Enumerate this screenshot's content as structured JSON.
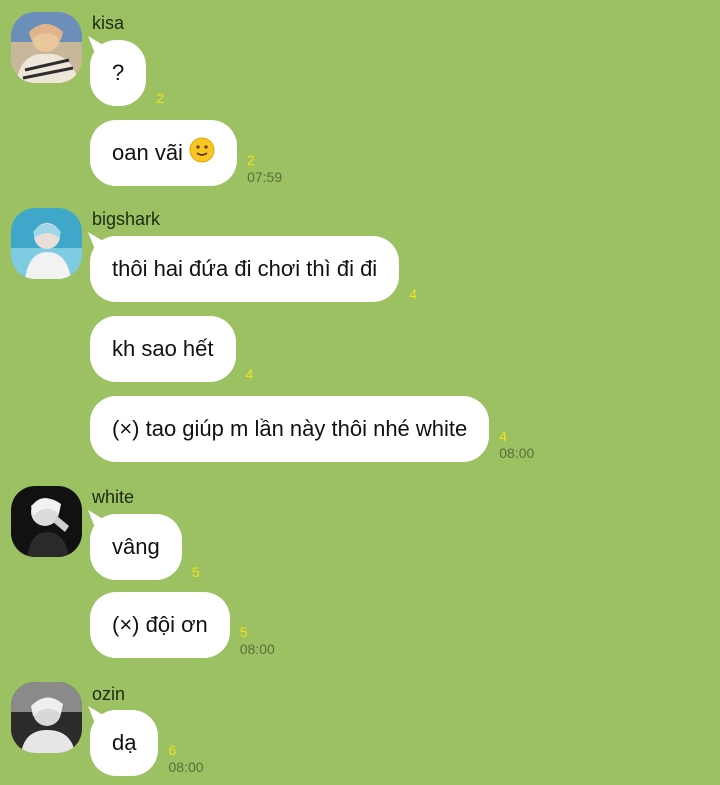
{
  "colors": {
    "background": "#9bc162",
    "bubble": "#ffffff",
    "read_count": "#f3e11d",
    "time": "#5a6f3a"
  },
  "groups": [
    {
      "sender": "kisa",
      "messages": [
        {
          "text": "?",
          "read": "2",
          "time": ""
        },
        {
          "text": "oan vãi",
          "emoji": "slightly-smiling-face",
          "read": "2",
          "time": "07:59"
        }
      ]
    },
    {
      "sender": "bigshark",
      "messages": [
        {
          "text": "thôi hai đứa đi chơi thì đi đi",
          "read": "4",
          "time": ""
        },
        {
          "text": "kh sao hết",
          "read": "4",
          "time": ""
        },
        {
          "text": "(×) tao giúp m lần này thôi nhé white",
          "read": "4",
          "time": "08:00"
        }
      ]
    },
    {
      "sender": "white",
      "messages": [
        {
          "text": "vâng",
          "read": "5",
          "time": ""
        },
        {
          "text": "(×) đội ơn",
          "read": "5",
          "time": "08:00"
        }
      ]
    },
    {
      "sender": "ozin",
      "messages": [
        {
          "text": "dạ",
          "read": "6",
          "time": "08:00"
        }
      ]
    }
  ]
}
